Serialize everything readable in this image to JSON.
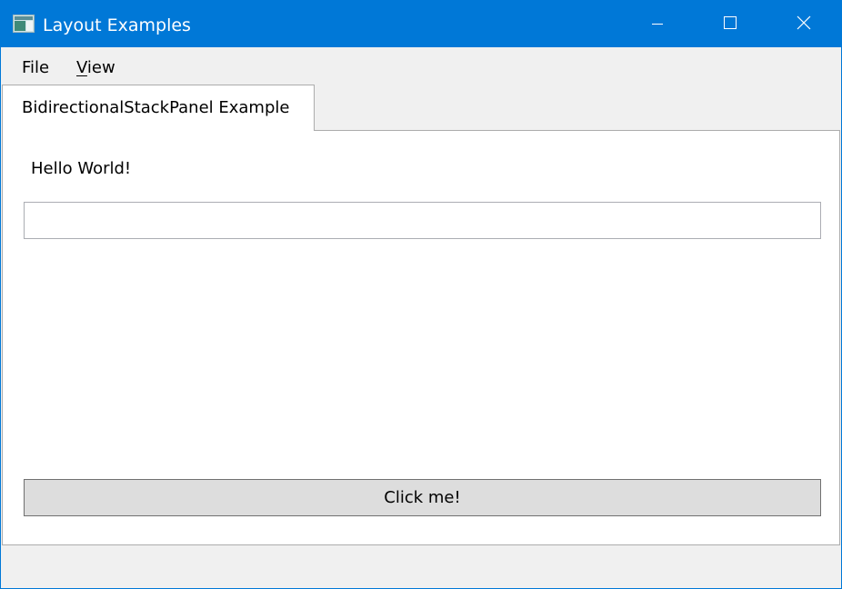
{
  "window": {
    "title": "Layout Examples",
    "accent_color": "#0078d7"
  },
  "menu": {
    "file_label": "File",
    "view_accel": "V",
    "view_rest": "iew"
  },
  "tabs": [
    {
      "label": "BidirectionalStackPanel Example",
      "selected": true
    }
  ],
  "content": {
    "greeting": "Hello World!",
    "input_value": "",
    "button_label": "Click me!"
  },
  "icons": {
    "app": "app-window-icon",
    "minimize": "minimize-icon",
    "maximize": "maximize-icon",
    "close": "close-icon"
  }
}
